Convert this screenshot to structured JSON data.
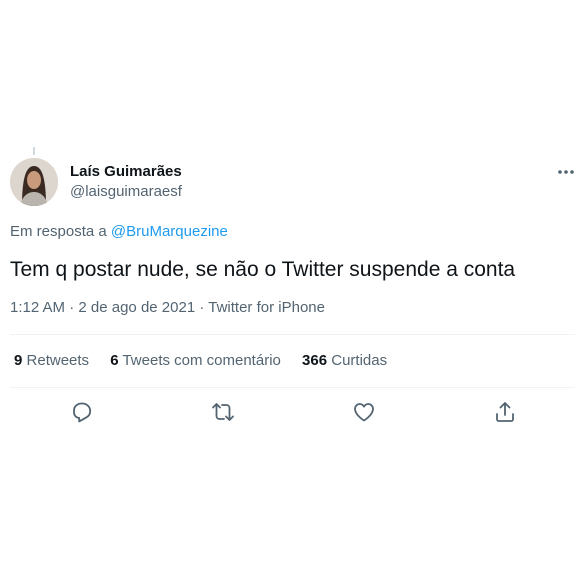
{
  "author": {
    "name": "Laís Guimarães",
    "handle": "@laisguimaraesf"
  },
  "reply": {
    "prefix": "Em resposta a",
    "mention": "@BruMarquezine"
  },
  "tweet": {
    "text": "Tem q postar nude, se não o Twitter suspende a conta",
    "time": "1:12 AM",
    "separator": "·",
    "date": "2 de ago de 2021",
    "source": "Twitter for iPhone"
  },
  "stats": {
    "retweets_count": "9",
    "retweets_label": "Retweets",
    "quotes_count": "6",
    "quotes_label": "Tweets com comentário",
    "likes_count": "366",
    "likes_label": "Curtidas"
  },
  "icons": {
    "more": "more-dots-icon",
    "reply": "reply-icon",
    "retweet": "retweet-icon",
    "like": "heart-icon",
    "share": "share-icon"
  },
  "colors": {
    "link": "#1d9bf0",
    "secondary_text": "#536471",
    "divider": "#eff3f4"
  }
}
